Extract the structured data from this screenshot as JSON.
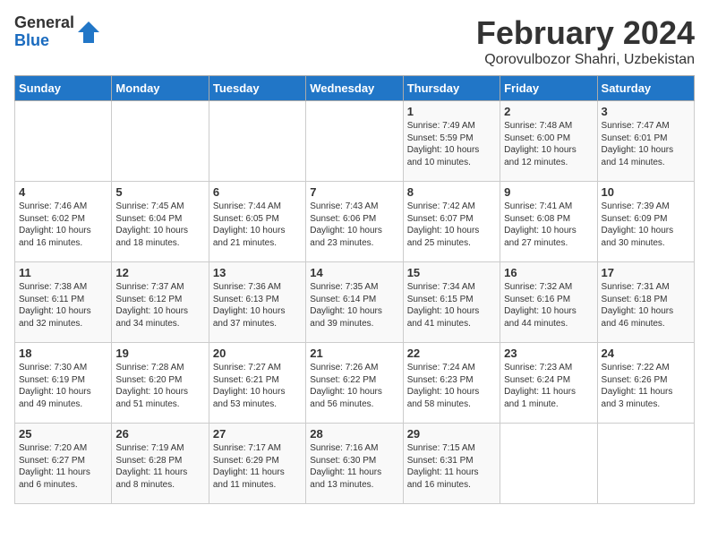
{
  "header": {
    "logo": {
      "general": "General",
      "blue": "Blue"
    },
    "title": "February 2024",
    "subtitle": "Qorovulbozor Shahri, Uzbekistan"
  },
  "weekdays": [
    "Sunday",
    "Monday",
    "Tuesday",
    "Wednesday",
    "Thursday",
    "Friday",
    "Saturday"
  ],
  "weeks": [
    [
      {
        "day": "",
        "info": ""
      },
      {
        "day": "",
        "info": ""
      },
      {
        "day": "",
        "info": ""
      },
      {
        "day": "",
        "info": ""
      },
      {
        "day": "1",
        "info": "Sunrise: 7:49 AM\nSunset: 5:59 PM\nDaylight: 10 hours\nand 10 minutes."
      },
      {
        "day": "2",
        "info": "Sunrise: 7:48 AM\nSunset: 6:00 PM\nDaylight: 10 hours\nand 12 minutes."
      },
      {
        "day": "3",
        "info": "Sunrise: 7:47 AM\nSunset: 6:01 PM\nDaylight: 10 hours\nand 14 minutes."
      }
    ],
    [
      {
        "day": "4",
        "info": "Sunrise: 7:46 AM\nSunset: 6:02 PM\nDaylight: 10 hours\nand 16 minutes."
      },
      {
        "day": "5",
        "info": "Sunrise: 7:45 AM\nSunset: 6:04 PM\nDaylight: 10 hours\nand 18 minutes."
      },
      {
        "day": "6",
        "info": "Sunrise: 7:44 AM\nSunset: 6:05 PM\nDaylight: 10 hours\nand 21 minutes."
      },
      {
        "day": "7",
        "info": "Sunrise: 7:43 AM\nSunset: 6:06 PM\nDaylight: 10 hours\nand 23 minutes."
      },
      {
        "day": "8",
        "info": "Sunrise: 7:42 AM\nSunset: 6:07 PM\nDaylight: 10 hours\nand 25 minutes."
      },
      {
        "day": "9",
        "info": "Sunrise: 7:41 AM\nSunset: 6:08 PM\nDaylight: 10 hours\nand 27 minutes."
      },
      {
        "day": "10",
        "info": "Sunrise: 7:39 AM\nSunset: 6:09 PM\nDaylight: 10 hours\nand 30 minutes."
      }
    ],
    [
      {
        "day": "11",
        "info": "Sunrise: 7:38 AM\nSunset: 6:11 PM\nDaylight: 10 hours\nand 32 minutes."
      },
      {
        "day": "12",
        "info": "Sunrise: 7:37 AM\nSunset: 6:12 PM\nDaylight: 10 hours\nand 34 minutes."
      },
      {
        "day": "13",
        "info": "Sunrise: 7:36 AM\nSunset: 6:13 PM\nDaylight: 10 hours\nand 37 minutes."
      },
      {
        "day": "14",
        "info": "Sunrise: 7:35 AM\nSunset: 6:14 PM\nDaylight: 10 hours\nand 39 minutes."
      },
      {
        "day": "15",
        "info": "Sunrise: 7:34 AM\nSunset: 6:15 PM\nDaylight: 10 hours\nand 41 minutes."
      },
      {
        "day": "16",
        "info": "Sunrise: 7:32 AM\nSunset: 6:16 PM\nDaylight: 10 hours\nand 44 minutes."
      },
      {
        "day": "17",
        "info": "Sunrise: 7:31 AM\nSunset: 6:18 PM\nDaylight: 10 hours\nand 46 minutes."
      }
    ],
    [
      {
        "day": "18",
        "info": "Sunrise: 7:30 AM\nSunset: 6:19 PM\nDaylight: 10 hours\nand 49 minutes."
      },
      {
        "day": "19",
        "info": "Sunrise: 7:28 AM\nSunset: 6:20 PM\nDaylight: 10 hours\nand 51 minutes."
      },
      {
        "day": "20",
        "info": "Sunrise: 7:27 AM\nSunset: 6:21 PM\nDaylight: 10 hours\nand 53 minutes."
      },
      {
        "day": "21",
        "info": "Sunrise: 7:26 AM\nSunset: 6:22 PM\nDaylight: 10 hours\nand 56 minutes."
      },
      {
        "day": "22",
        "info": "Sunrise: 7:24 AM\nSunset: 6:23 PM\nDaylight: 10 hours\nand 58 minutes."
      },
      {
        "day": "23",
        "info": "Sunrise: 7:23 AM\nSunset: 6:24 PM\nDaylight: 11 hours\nand 1 minute."
      },
      {
        "day": "24",
        "info": "Sunrise: 7:22 AM\nSunset: 6:26 PM\nDaylight: 11 hours\nand 3 minutes."
      }
    ],
    [
      {
        "day": "25",
        "info": "Sunrise: 7:20 AM\nSunset: 6:27 PM\nDaylight: 11 hours\nand 6 minutes."
      },
      {
        "day": "26",
        "info": "Sunrise: 7:19 AM\nSunset: 6:28 PM\nDaylight: 11 hours\nand 8 minutes."
      },
      {
        "day": "27",
        "info": "Sunrise: 7:17 AM\nSunset: 6:29 PM\nDaylight: 11 hours\nand 11 minutes."
      },
      {
        "day": "28",
        "info": "Sunrise: 7:16 AM\nSunset: 6:30 PM\nDaylight: 11 hours\nand 13 minutes."
      },
      {
        "day": "29",
        "info": "Sunrise: 7:15 AM\nSunset: 6:31 PM\nDaylight: 11 hours\nand 16 minutes."
      },
      {
        "day": "",
        "info": ""
      },
      {
        "day": "",
        "info": ""
      }
    ]
  ]
}
